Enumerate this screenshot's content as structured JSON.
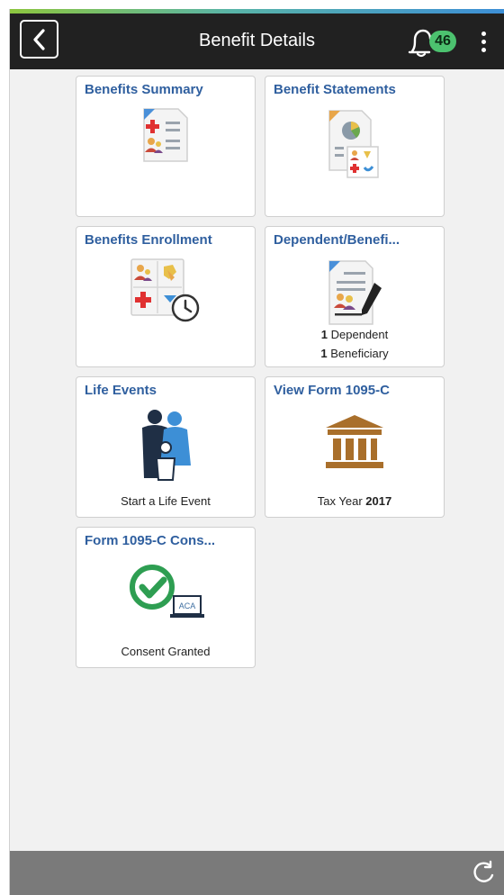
{
  "header": {
    "title": "Benefit Details",
    "notification_count": "46",
    "icons": {
      "back": "chevron-left-icon",
      "notifications": "bell-icon",
      "menu": "more-vertical-icon"
    }
  },
  "tiles": {
    "benefits_summary": {
      "title": "Benefits Summary",
      "icon": "medical-summary-icon"
    },
    "benefit_statements": {
      "title": "Benefit Statements",
      "icon": "statement-chart-icon"
    },
    "benefits_enrollment": {
      "title": "Benefits Enrollment",
      "icon": "enrollment-clock-icon"
    },
    "dependent_beneficiary": {
      "title": "Dependent/Benefi...",
      "icon": "document-sign-icon",
      "dependent_count": "1",
      "dependent_label": "Dependent",
      "beneficiary_count": "1",
      "beneficiary_label": "Beneficiary"
    },
    "life_events": {
      "title": "Life Events",
      "icon": "family-icon",
      "caption": "Start a Life Event"
    },
    "view_form_1095c": {
      "title": "View Form 1095-C",
      "icon": "government-building-icon",
      "caption_prefix": "Tax Year",
      "year": "2017"
    },
    "form_1095c_consent": {
      "title": "Form 1095-C Cons...",
      "icon": "check-laptop-icon",
      "laptop_label": "ACA",
      "caption": "Consent Granted"
    }
  },
  "footer": {
    "icon": "refresh-icon"
  },
  "colors": {
    "header_bg": "#212121",
    "badge": "#4cc26f",
    "tile_title": "#2f5f9f",
    "footer_bg": "#7a7a7a"
  }
}
